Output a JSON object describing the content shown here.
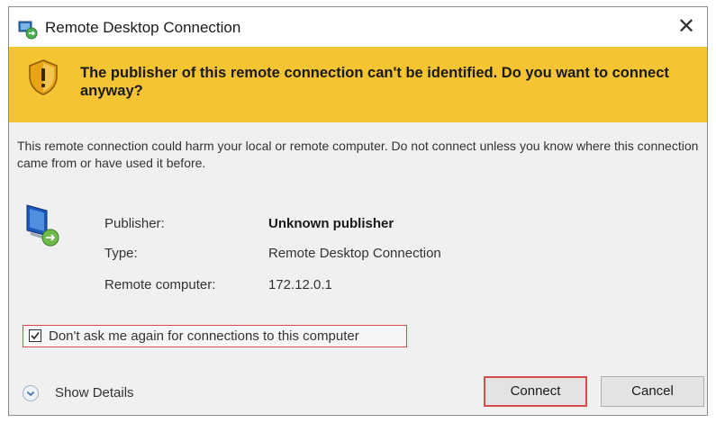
{
  "window": {
    "title": "Remote Desktop Connection"
  },
  "warning": {
    "text": "The publisher of this remote connection can't be identified. Do you want to connect anyway?"
  },
  "description": "This remote connection could harm your local or remote computer. Do not connect unless you know where this connection came from or have used it before.",
  "info": {
    "publisher_label": "Publisher:",
    "publisher_value": "Unknown publisher",
    "type_label": "Type:",
    "type_value": "Remote Desktop Connection",
    "remote_label": "Remote computer:",
    "remote_value": "172.12.0.1"
  },
  "dont_ask": {
    "label": "Don't ask me again for connections to this computer",
    "checked": true
  },
  "buttons": {
    "show_details": "Show Details",
    "connect": "Connect",
    "cancel": "Cancel"
  },
  "colors": {
    "warning_bar": "#f4c432",
    "highlight": "#d94b4b"
  },
  "icons": [
    "remote-desktop-app-icon",
    "close-icon",
    "warning-shield-icon",
    "computer-icon",
    "checkmark-icon",
    "expand-chevron-icon"
  ]
}
